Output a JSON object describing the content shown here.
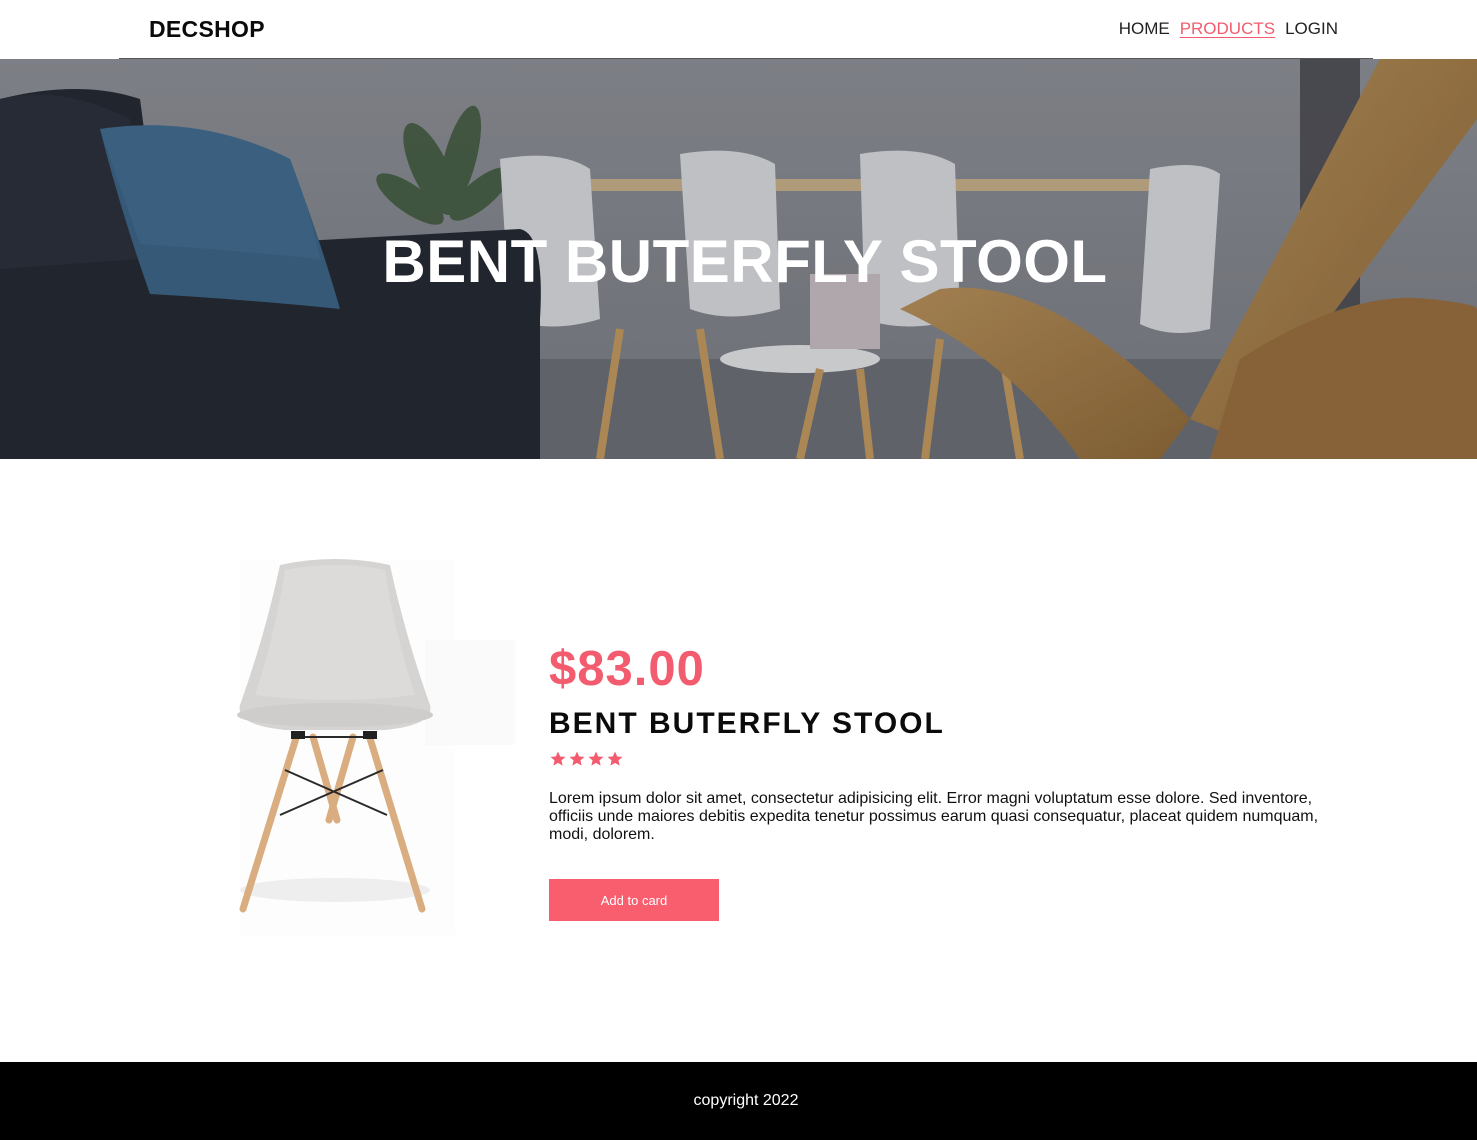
{
  "header": {
    "brand": "DECSHOP",
    "nav": [
      {
        "label": "HOME",
        "active": false
      },
      {
        "label": "PRODUCTS",
        "active": true
      },
      {
        "label": "LOGIN",
        "active": false
      }
    ]
  },
  "hero": {
    "title": "BENT BUTERFLY STOOL"
  },
  "product": {
    "price": "$83.00",
    "name": "BENT BUTERFLY STOOL",
    "rating": 4,
    "description": "Lorem ipsum dolor sit amet, consectetur adipisicing elit. Error magni voluptatum esse dolore. Sed inventore, officiis unde maiores debitis expedita tenetur possimus earum quasi consequatur, placeat quidem numquam, modi, dolorem.",
    "add_label": "Add to card"
  },
  "footer": {
    "copyright": "copyright 2022"
  },
  "colors": {
    "accent": "#f25c6e",
    "button": "#f95e6f",
    "footer_bg": "#000000"
  }
}
